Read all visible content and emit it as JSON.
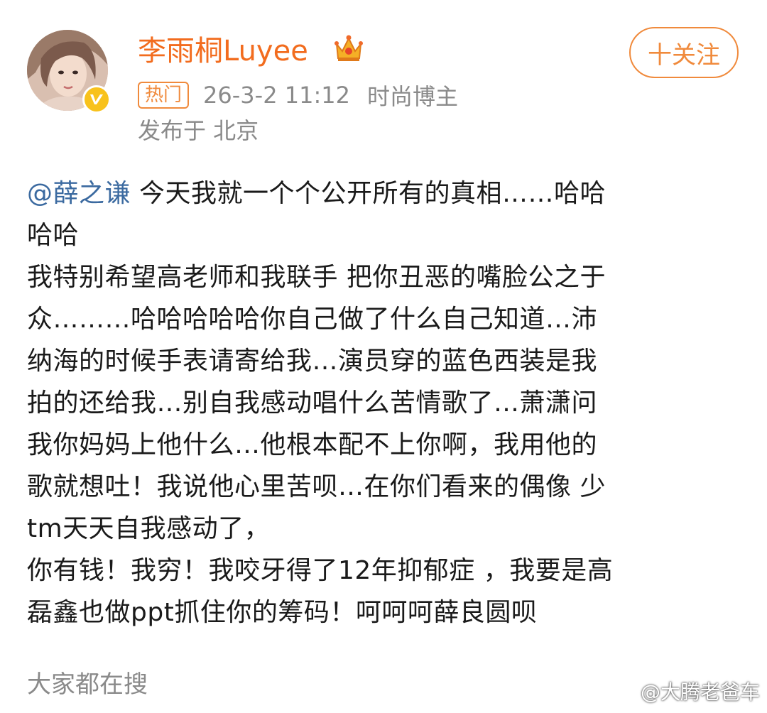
{
  "user": {
    "name": "李雨桐Luyee",
    "avatar_icon": "avatar-image",
    "verified_icon": "verified-v-icon",
    "crown_icon": "crown-icon",
    "verified_color": "#f8c21c",
    "name_color": "#f26c1e"
  },
  "follow_button": {
    "label": "十关注"
  },
  "meta": {
    "badge": "热门",
    "time": "26-3-2 11:12",
    "tag": "时尚博主",
    "location": "发布于 北京"
  },
  "post": {
    "mention": "@薛之谦",
    "lines": [
      " 今天我就一个个公开所有的真相……哈哈",
      "哈哈",
      "我特别希望高老师和我联手 把你丑恶的嘴脸公之于",
      "众………哈哈哈哈哈你自己做了什么自己知道…沛",
      "纳海的时候手表请寄给我…演员穿的蓝色西装是我",
      "拍的还给我…别自我感动唱什么苦情歌了…萧潇问",
      "我你妈妈上他什么…他根本配不上你啊，我用他的",
      "歌就想吐！我说他心里苦呗…在你们看来的偶像 少",
      "tm天天自我感动了，",
      "你有钱！我穷！我咬牙得了12年抑郁症 ，我要是高",
      "磊鑫也做ppt抓住你的筹码！呵呵呵薛良圆呗"
    ]
  },
  "footer": {
    "label": "大家都在搜"
  },
  "watermark": {
    "text": "@大腾老爸车",
    "icon": "weibo-icon"
  }
}
